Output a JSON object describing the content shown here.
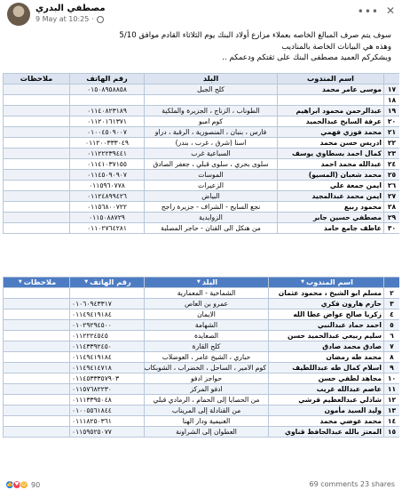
{
  "post": {
    "author": "مصطفي البدري",
    "timestamp": "9 May at 10:25",
    "text_lines": [
      "سوف يتم صرف المبالغ الخاصه بعملاء مزارع أولاد البنك يوم الثلاثاء القادم موافق 5/10",
      "وهذه هي البيانات الخاصة بالمناديب",
      "ويشكركم العميد مصطفى البنك على ثقتكم ودعمكم .."
    ]
  },
  "table1": {
    "headers": [
      "اسم المندوب",
      "البلد",
      "رقم الهاتف",
      "ملاحظات"
    ],
    "rows": [
      {
        "num": "١٧",
        "name": "موسى عامر محمد",
        "town": "كلح الجبل",
        "phone": "٠١٥٠٨٩٥٨٨٥٨",
        "note": ""
      },
      {
        "num": "١٨",
        "name": "",
        "town": "",
        "phone": "",
        "note": ""
      },
      {
        "num": "١٩",
        "name": "عبدالرحمن محمود ابراهيم",
        "town": "الطوناب ، الزناج ، الجزيرة والملكية",
        "phone": "٠١١٤٠٨٢٣١٨٩",
        "note": ""
      },
      {
        "num": "٢٠",
        "name": "عرفة السايح عبدالحميد",
        "town": "كوم امبو",
        "phone": "٠١١٢٠١٦١٣٧١",
        "note": ""
      },
      {
        "num": "٢١",
        "name": "محمد فوزي فهمي",
        "town": "فارس ، بنبان ، المنصورية ، الرقبة ، دراو",
        "phone": "٠١٠٠٤٥٠٩٠٠٧",
        "note": ""
      },
      {
        "num": "٢٢",
        "name": "ادريس حسن محمد",
        "town": "اسنا (شرق ، غرب ، بندر)",
        "phone": "٠١١٢٠٠٣٣٣٠٤٩",
        "note": ""
      },
      {
        "num": "٢٣",
        "name": "كمال احمد بسطاوي يوسف",
        "town": "السباعية غرب",
        "phone": "٠١١٢٢٢٣٩٤٤١",
        "note": ""
      },
      {
        "num": "٢٤",
        "name": "عبدالله محمد احمد",
        "town": "سلوى بحري ، سلوى قبلي ، جعفر الصادق",
        "phone": "٠١١٤١٠٣٧١٥٥",
        "note": ""
      },
      {
        "num": "٢٥",
        "name": "محمد شعبان (المسيو)",
        "town": "الموسات",
        "phone": "٠١١٤٥٠٩٠٩٠٧",
        "note": ""
      },
      {
        "num": "٢٦",
        "name": "ايمن جمعة علي",
        "town": "الزعيرات",
        "phone": "٠١١٥٩٦٠٧٧٨",
        "note": ""
      },
      {
        "num": "٢٧",
        "name": "ايمن محمد عبدالمجيد",
        "town": "البياض",
        "phone": "٠١١٢٤٨٩٩٤٢٦",
        "note": ""
      },
      {
        "num": "٢٨",
        "name": "محمود ربيع",
        "town": "نجع السايح - الشراف - جزيرة راجح",
        "phone": "٠١١٥٦٨٠٠٧٢٢",
        "note": ""
      },
      {
        "num": "٢٩",
        "name": "مصطفي حسين جابر",
        "town": "الزوايدية",
        "phone": "٠١١٥٠٨٨٧٢٩",
        "note": ""
      },
      {
        "num": "٣٠",
        "name": "عاطف جامع حامد",
        "town": "من هنكل الى القنان - حاجر المصلبة",
        "phone": "٠١١٠٢٧٦٤٢٨١",
        "note": ""
      }
    ]
  },
  "table2": {
    "headers": [
      "اسم المندوب",
      "البلد",
      "رقم الهاتف",
      "ملاحظات"
    ],
    "rows": [
      {
        "num": "٢",
        "name": "مسلم ابو الشيخ ، محمود عثمان",
        "town": "الشماخية - المعمارية",
        "phone": "",
        "note": ""
      },
      {
        "num": "٣",
        "name": "حازم هارون فكري",
        "town": "عمرو بن العاص",
        "phone": "٠١٠٦٠٩٤٣٣١٧",
        "note": ""
      },
      {
        "num": "٤",
        "name": "زكريا صالح عواض عطا الله",
        "town": "الايمان",
        "phone": "٠١١٤٩٤١٩١٨٤",
        "note": ""
      },
      {
        "num": "٥",
        "name": "احمد حماد عبدالنبي",
        "town": "الشهامة",
        "phone": "٠١٠٢٩٢٩٤٥٠٠",
        "note": ""
      },
      {
        "num": "٦",
        "name": "سليم ربيعي عبدالحميد حسن",
        "town": "الصعايدة",
        "phone": "٠١١٢٢٢٤٥٤٥",
        "note": ""
      },
      {
        "num": "٧",
        "name": "صادق محمد صادق",
        "town": "كلح القارة",
        "phone": "٠١١٤٣٣٩٢٤٥٠",
        "note": ""
      },
      {
        "num": "٨",
        "name": "محمد طه رمضان",
        "town": "حباري ، الشيخ عامر ، العوضلاب",
        "phone": "٠١١٤٩٤١٩١٨٤",
        "note": ""
      },
      {
        "num": "٩",
        "name": "اسلام كمال طه عبداللطيف",
        "town": "كوم الامير ، الساحل ، الخضراب ، الشوبكاب",
        "phone": "٠١١٤٩٤١٤٧١٨",
        "note": ""
      },
      {
        "num": "١٠",
        "name": "مجاهد لطفي حسن",
        "town": "حواجز ادفو",
        "phone": "٠١١٤٥٣٣٣٥٧٩٠٣",
        "note": ""
      },
      {
        "num": "١١",
        "name": "عاصم عبدالله غريب",
        "town": "ادفو المركز",
        "phone": "٠١١٥٧٦٨٢٢٣٠",
        "note": ""
      },
      {
        "num": "١٢",
        "name": "شاذلي عبدالعظيم قرشي",
        "town": "من الحصايا إلى الحمام ، الرمادي قبلي",
        "phone": "٠١١١٣٣٩٥٠٤٨",
        "note": ""
      },
      {
        "num": "١٣",
        "name": "وليد السيد مأمون",
        "town": "من القنادلة إلى المريناب",
        "phone": "٠١٠٠٥٥٦١٨٤٤",
        "note": ""
      },
      {
        "num": "١٤",
        "name": "محمد عوضي محمد",
        "town": "الغنيمية ودار الهنا",
        "phone": "٠١١١٨٢٥٠٣٦١",
        "note": ""
      },
      {
        "num": "١٥",
        "name": "المعتز بالله عبدالحافظ قناوي",
        "town": "العطوان إلى الشراونة",
        "phone": "٠١١٥٩٥٢٥٠٧٧",
        "note": ""
      }
    ]
  },
  "footer": {
    "reaction_count": "90",
    "stats": "69 comments  23 shares"
  },
  "colors": {
    "table1_header": "#dbe4f0",
    "table2_header": "#4d7cc3",
    "grid": "#b9c7da"
  },
  "icons": [
    "more-options-icon",
    "close-icon",
    "globe-icon",
    "like-reaction-icon",
    "love-reaction-icon",
    "care-reaction-icon"
  ]
}
